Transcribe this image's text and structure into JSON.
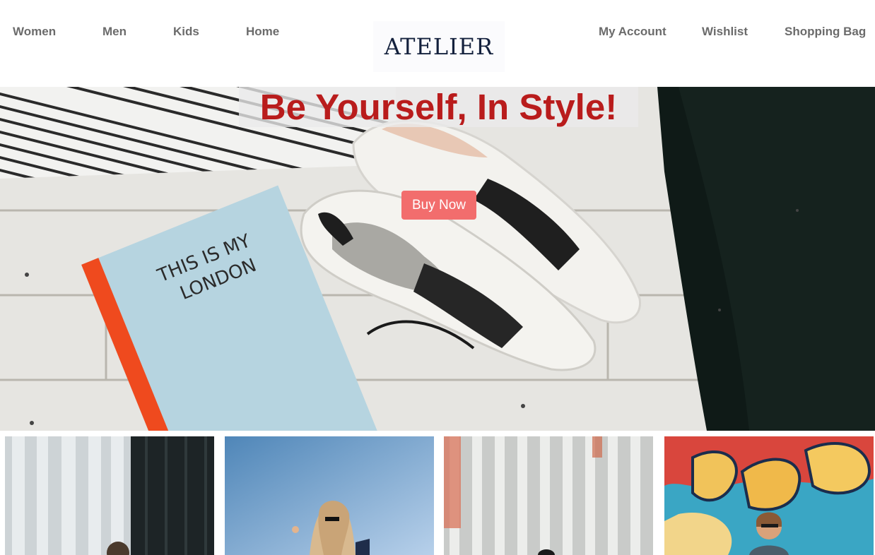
{
  "nav": {
    "left": [
      "Women",
      "Men",
      "Kids",
      "Home"
    ],
    "right": [
      "My Account",
      "Wishlist",
      "Shopping Bag"
    ]
  },
  "brand": {
    "logo": "ATELIER"
  },
  "hero": {
    "title": "Be Yourself, In Style!",
    "button": "Buy Now",
    "notebook_text_line1": "THIS IS MY",
    "notebook_text_line2": "LONDON"
  },
  "colors": {
    "nav_text": "#6b6b6b",
    "logo": "#14213d",
    "title": "#b91c1c",
    "button": "#f26d6d"
  }
}
